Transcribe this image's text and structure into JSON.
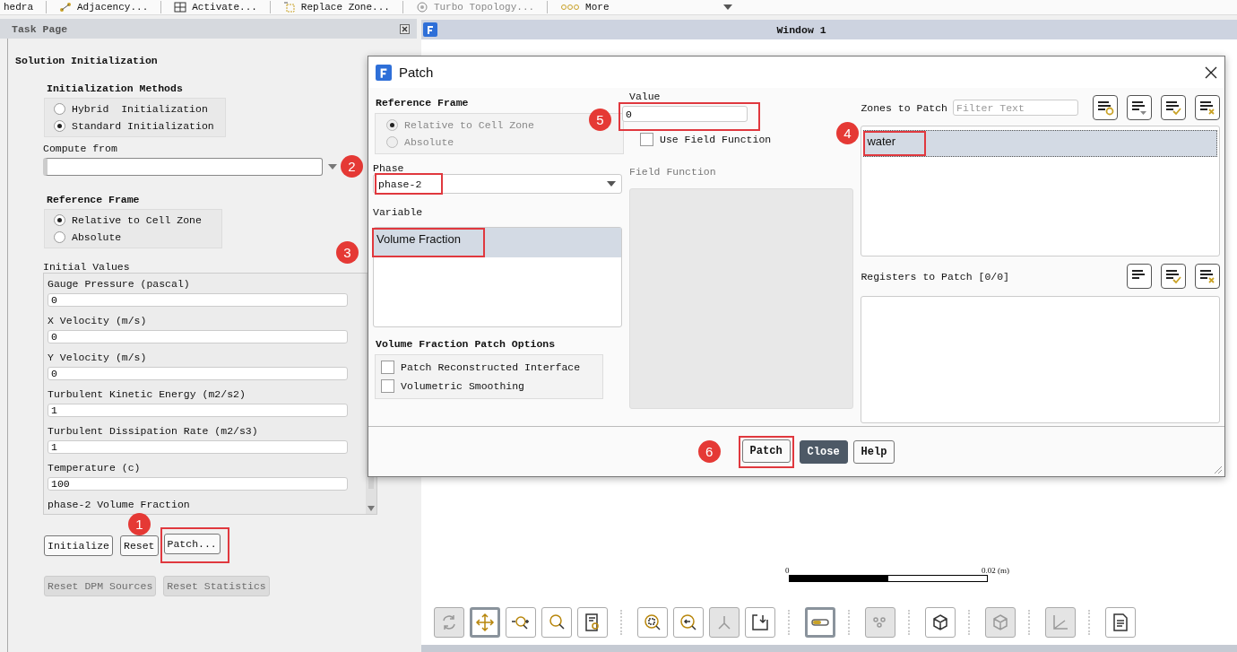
{
  "toolbar": [
    {
      "label": "hedra"
    },
    {
      "label": "Adjacency..."
    },
    {
      "label": "Activate..."
    },
    {
      "label": "Replace Zone..."
    },
    {
      "label": "Turbo Topology..."
    },
    {
      "label": "More"
    }
  ],
  "task_page": {
    "title": "Task Page",
    "heading": "Solution Initialization",
    "methods": {
      "title": "Initialization Methods",
      "options": [
        {
          "label": "Hybrid  Initialization",
          "selected": false
        },
        {
          "label": "Standard Initialization",
          "selected": true
        }
      ]
    },
    "compute_from": {
      "label": "Compute from"
    },
    "reference_frame": {
      "title": "Reference Frame",
      "options": [
        {
          "label": "Relative to Cell Zone",
          "selected": true
        },
        {
          "label": "Absolute",
          "selected": false
        }
      ]
    },
    "initial_values": {
      "title": "Initial Values",
      "fields": [
        {
          "label": "Gauge Pressure (pascal)",
          "value": "0"
        },
        {
          "label": "X Velocity (m/s)",
          "value": "0"
        },
        {
          "label": "Y Velocity (m/s)",
          "value": "0"
        },
        {
          "label": "Turbulent Kinetic Energy (m2/s2)",
          "value": "1"
        },
        {
          "label": "Turbulent Dissipation Rate (m2/s3)",
          "value": "1"
        },
        {
          "label": "Temperature (c)",
          "value": "100"
        }
      ],
      "trailing_label": "phase-2 Volume Fraction"
    },
    "buttons": [
      {
        "label": "Initialize",
        "disabled": false
      },
      {
        "label": "Reset",
        "disabled": false
      },
      {
        "label": "Patch...",
        "disabled": false
      }
    ],
    "secondary_buttons": [
      {
        "label": "Reset DPM Sources",
        "disabled": true
      },
      {
        "label": "Reset Statistics",
        "disabled": true
      }
    ]
  },
  "graphics_window": {
    "title": "Window 1",
    "scale": {
      "start": "0",
      "end": "0.02 (m)"
    },
    "tools": [
      {
        "kind": "rotate",
        "selected": false,
        "disabled": true
      },
      {
        "kind": "pan",
        "selected": true,
        "disabled": false
      },
      {
        "kind": "zoom-in-out",
        "selected": false,
        "disabled": false
      },
      {
        "kind": "zoom",
        "selected": false,
        "disabled": false
      },
      {
        "kind": "fit",
        "selected": false,
        "disabled": false
      },
      {
        "kind": "box-zoom",
        "selected": false,
        "disabled": false
      },
      {
        "kind": "zoom-back",
        "selected": false,
        "disabled": false
      },
      {
        "kind": "axes",
        "selected": false,
        "disabled": true
      },
      {
        "kind": "export",
        "selected": false,
        "disabled": false
      },
      {
        "kind": "transparency",
        "selected": true,
        "disabled": false
      },
      {
        "kind": "scene",
        "selected": false,
        "disabled": true
      },
      {
        "kind": "cube",
        "selected": false,
        "disabled": false
      },
      {
        "kind": "cube",
        "selected": false,
        "disabled": true
      },
      {
        "kind": "axis-arrow",
        "selected": false,
        "disabled": true
      },
      {
        "kind": "notes",
        "selected": false,
        "disabled": false
      }
    ]
  },
  "dialog": {
    "title": "Patch",
    "reference_frame": {
      "title": "Reference Frame",
      "disabled": true,
      "options": [
        {
          "label": "Relative to Cell Zone",
          "selected": true
        },
        {
          "label": "Absolute",
          "selected": false
        }
      ]
    },
    "phase": {
      "label": "Phase",
      "value": "phase-2"
    },
    "variable": {
      "label": "Variable",
      "items": [
        {
          "label": "Volume Fraction",
          "selected": true
        }
      ]
    },
    "patch_options": {
      "title": "Volume Fraction Patch Options",
      "options": [
        {
          "label": "Patch Reconstructed Interface",
          "checked": false
        },
        {
          "label": "Volumetric Smoothing",
          "checked": false
        }
      ]
    },
    "value": {
      "label": "Value",
      "value": "0"
    },
    "use_field_function": {
      "label": "Use Field Function",
      "checked": false
    },
    "field_function": {
      "label": "Field Function",
      "disabled": true
    },
    "zones": {
      "label": "Zones to Patch",
      "placeholder": "Filter Text",
      "items": [
        {
          "label": "water",
          "selected": true
        }
      ]
    },
    "registers": {
      "label": "Registers to Patch [0/0]"
    },
    "buttons": [
      {
        "label": "Patch",
        "primary": false
      },
      {
        "label": "Close",
        "primary": true
      },
      {
        "label": "Help",
        "primary": false
      }
    ]
  },
  "annotations": [
    {
      "number": "1"
    },
    {
      "number": "2"
    },
    {
      "number": "3"
    },
    {
      "number": "4"
    },
    {
      "number": "5"
    },
    {
      "number": "6"
    }
  ]
}
